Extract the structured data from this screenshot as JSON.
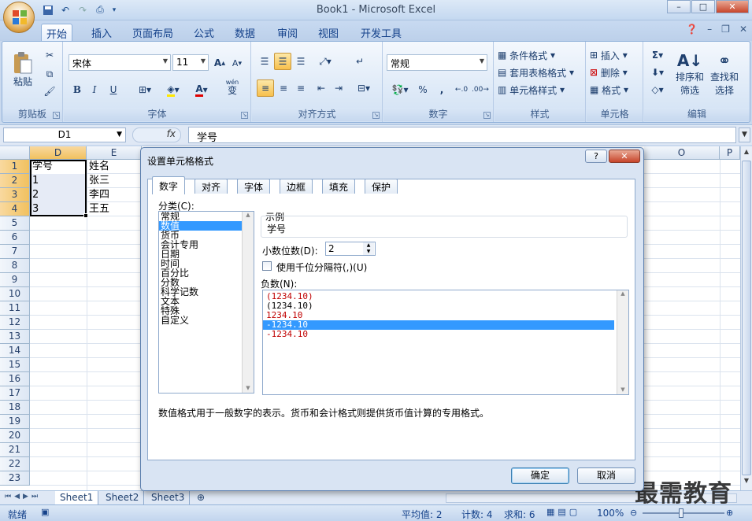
{
  "window": {
    "title": "Book1 - Microsoft Excel",
    "min": "–",
    "max": "□",
    "close": "✕"
  },
  "ribbon_tabs": [
    "开始",
    "插入",
    "页面布局",
    "公式",
    "数据",
    "审阅",
    "视图",
    "开发工具"
  ],
  "clipboard": {
    "paste": "粘贴",
    "group": "剪贴板"
  },
  "font": {
    "name": "宋体",
    "size": "11",
    "bold": "B",
    "italic": "I",
    "underline": "U",
    "phonetic": "wén",
    "phonetic2": "变",
    "group": "字体"
  },
  "alignment": {
    "group": "对齐方式"
  },
  "number": {
    "format": "常规",
    "percent": "%",
    "comma": ",",
    "group": "数字"
  },
  "styles": {
    "cond": "条件格式",
    "table": "套用表格格式",
    "cell": "单元格样式",
    "group": "样式"
  },
  "cells": {
    "insert": "插入",
    "delete": "删除",
    "format": "格式",
    "group": "单元格"
  },
  "editing": {
    "sort": "排序和",
    "sort2": "筛选",
    "find": "查找和",
    "find2": "选择",
    "group": "编辑"
  },
  "formula": {
    "namebox": "D1",
    "fx": "fx",
    "value": "学号"
  },
  "columns": [
    "D",
    "E",
    "O",
    "P"
  ],
  "rows": [
    "1",
    "2",
    "3",
    "4",
    "5",
    "6",
    "7",
    "8",
    "9",
    "10",
    "11",
    "12",
    "13",
    "14",
    "15",
    "16",
    "17",
    "18",
    "19",
    "20",
    "21",
    "22",
    "23"
  ],
  "cells_d": [
    "学号",
    "1",
    "2",
    "3"
  ],
  "cells_e": [
    "姓名",
    "张三",
    "李四",
    "王五"
  ],
  "dialog": {
    "title": "设置单元格格式",
    "help": "?",
    "close": "✕",
    "tabs": [
      "数字",
      "对齐",
      "字体",
      "边框",
      "填充",
      "保护"
    ],
    "category_label": "分类(C):",
    "categories": [
      "常规",
      "数值",
      "货币",
      "会计专用",
      "日期",
      "时间",
      "百分比",
      "分数",
      "科学记数",
      "文本",
      "特殊",
      "自定义"
    ],
    "sample_label": "示例",
    "sample_value": "学号",
    "decimals_label": "小数位数(D):",
    "decimals_value": "2",
    "thousands_label": "使用千位分隔符(,)(U)",
    "negative_label": "负数(N):",
    "negatives": [
      "(1234.10)",
      "(1234.10)",
      "1234.10",
      "-1234.10",
      "-1234.10"
    ],
    "description": "数值格式用于一般数字的表示。货币和会计格式则提供货币值计算的专用格式。",
    "ok": "确定",
    "cancel": "取消"
  },
  "sheets": [
    "Sheet1",
    "Sheet2",
    "Sheet3"
  ],
  "status": {
    "ready": "就绪",
    "average": "平均值: 2",
    "count": "计数: 4",
    "sum": "求和: 6",
    "zoom": "100%"
  },
  "watermark": "最需教育"
}
